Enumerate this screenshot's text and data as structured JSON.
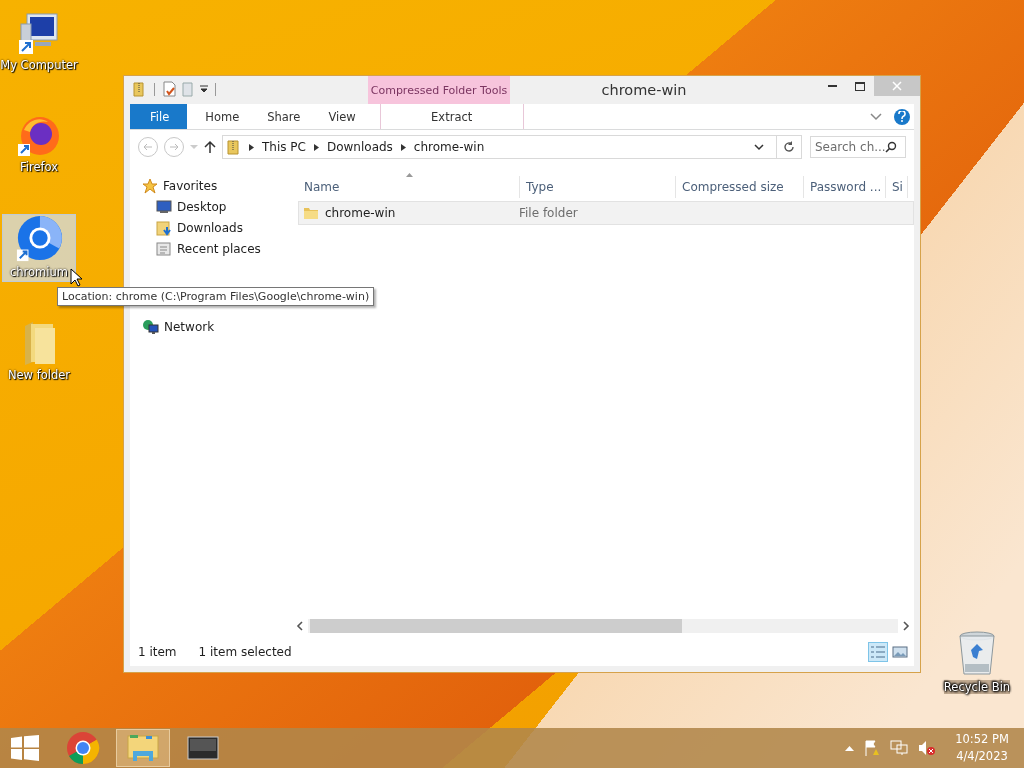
{
  "desktop_icons": [
    {
      "label": "My Computer",
      "kind": "computer",
      "selected": false
    },
    {
      "label": "Firefox",
      "kind": "firefox",
      "selected": false
    },
    {
      "label": "chromium",
      "kind": "chromium",
      "selected": true
    },
    {
      "label": "New folder",
      "kind": "folder",
      "selected": false
    },
    {
      "label": "Recycle Bin",
      "kind": "bin",
      "selected": false
    }
  ],
  "tooltip": "Location: chrome (C:\\Program Files\\Google\\chrome-win)",
  "window": {
    "title": "chrome-win",
    "context_group": "Compressed Folder Tools",
    "ribbon_tabs": [
      {
        "label": "File",
        "kind": "file",
        "selected": false
      },
      {
        "label": "Home",
        "kind": "tab",
        "selected": false
      },
      {
        "label": "Share",
        "kind": "tab",
        "selected": false
      },
      {
        "label": "View",
        "kind": "tab",
        "selected": false
      },
      {
        "label": "Extract",
        "kind": "context",
        "selected": false
      }
    ],
    "breadcrumb": [
      "This PC",
      "Downloads",
      "chrome-win"
    ],
    "search": {
      "placeholder": "Search ch..."
    },
    "nav": [
      {
        "label": "Favorites",
        "kind": "star",
        "children": [
          {
            "label": "Desktop",
            "kind": "desktop"
          },
          {
            "label": "Downloads",
            "kind": "downloads"
          },
          {
            "label": "Recent places",
            "kind": "recent"
          }
        ]
      },
      {
        "label": "Network",
        "kind": "network"
      }
    ],
    "columns": [
      "Name",
      "Type",
      "Compressed size",
      "Password ...",
      "Si"
    ],
    "rows": [
      {
        "cells": [
          "chrome-win",
          "File folder"
        ],
        "selected": true
      }
    ],
    "status": [
      "1 item",
      "1 item selected"
    ],
    "view_buttons": [
      {
        "kind": "details",
        "selected": true
      },
      {
        "kind": "tiles",
        "selected": false
      }
    ]
  },
  "taskbar": {
    "apps": [
      {
        "kind": "chrome",
        "active": false
      },
      {
        "kind": "explorer",
        "active": true
      },
      {
        "kind": "terminal",
        "active": false
      }
    ],
    "time": "10:52 PM",
    "date": "4/4/2023"
  }
}
